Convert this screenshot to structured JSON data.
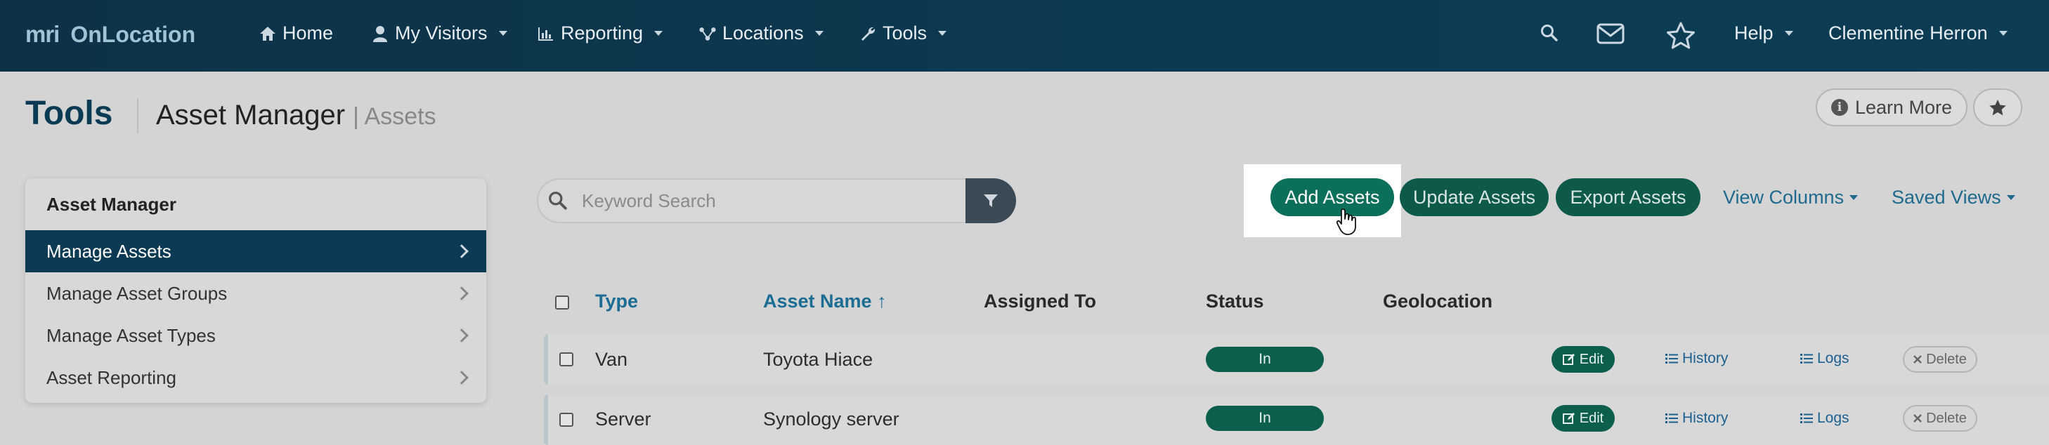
{
  "brand": {
    "logo": "mri",
    "name": "OnLocation"
  },
  "nav": {
    "home": "Home",
    "visitors": "My Visitors",
    "reporting": "Reporting",
    "locations": "Locations",
    "tools": "Tools",
    "help": "Help",
    "user": "Clementine Herron"
  },
  "header": {
    "section": "Tools",
    "title": "Asset Manager",
    "subtitle": "| Assets",
    "learn_more": "Learn More"
  },
  "sidebar": {
    "heading": "Asset Manager",
    "items": [
      {
        "label": "Manage Assets",
        "active": true
      },
      {
        "label": "Manage Asset Groups",
        "active": false
      },
      {
        "label": "Manage Asset Types",
        "active": false
      },
      {
        "label": "Asset Reporting",
        "active": false
      }
    ]
  },
  "search": {
    "placeholder": "Keyword Search"
  },
  "actions": {
    "add": "Add Assets",
    "update": "Update Assets",
    "export": "Export Assets",
    "view_columns": "View Columns",
    "saved_views": "Saved Views"
  },
  "table": {
    "columns": [
      "Type",
      "Asset Name ↑",
      "Assigned To",
      "Status",
      "Geolocation"
    ],
    "rows": [
      {
        "type": "Van",
        "name": "Toyota Hiace",
        "assigned": "",
        "status": "In",
        "geo": ""
      },
      {
        "type": "Server",
        "name": "Synology server",
        "assigned": "",
        "status": "In",
        "geo": ""
      }
    ],
    "row_actions": {
      "edit": "Edit",
      "history": "History",
      "logs": "Logs",
      "delete": "Delete"
    }
  },
  "colors": {
    "navbar": "#0b3a52",
    "accent_green": "#0b6e5a",
    "link_blue": "#1c6d94"
  }
}
